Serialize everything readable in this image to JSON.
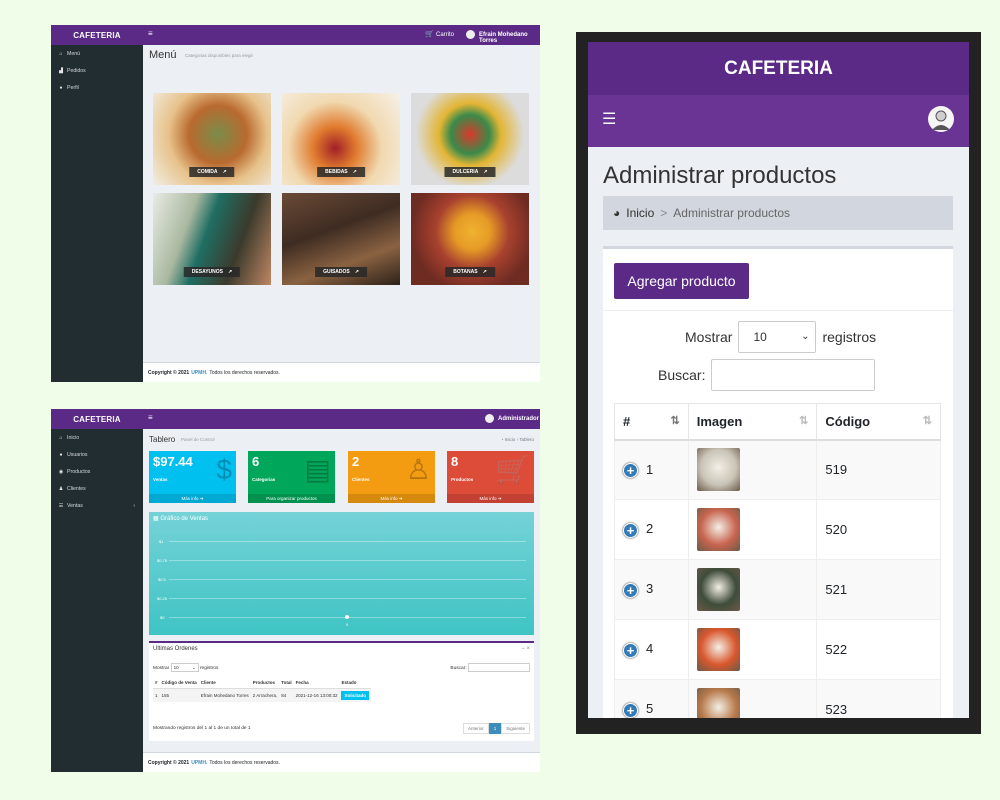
{
  "menu_screen": {
    "brand": "CAFETERIA",
    "topbar": {
      "cart_label": "Carrito",
      "user_name": "Efrain Mohedano Torres"
    },
    "sidebar": [
      {
        "icon": "home-icon",
        "label": "Menú"
      },
      {
        "icon": "chart-icon",
        "label": "Pedidos"
      },
      {
        "icon": "user-icon",
        "label": "Perfil"
      }
    ],
    "title": "Menú",
    "subtitle": "Categorias disponibles para elegir",
    "categories": [
      "COMIDA",
      "BEBIDAS",
      "DULCERIA",
      "DESAYUNOS",
      "GUISADOS",
      "BOTANAS"
    ],
    "footer": {
      "copyright": "Copyright © 2021",
      "company": "UPMH.",
      "rights": "Todos los derechos reservados."
    }
  },
  "dashboard_screen": {
    "brand": "CAFETERIA",
    "topbar": {
      "user_name": "Administrador"
    },
    "sidebar": [
      {
        "icon": "home-icon",
        "label": "Inicio"
      },
      {
        "icon": "user-icon",
        "label": "Usuarios"
      },
      {
        "icon": "box-icon",
        "label": "Productos"
      },
      {
        "icon": "users-icon",
        "label": "Clientes"
      },
      {
        "icon": "list-icon",
        "label": "Ventas"
      }
    ],
    "title": "Tablero",
    "subtitle": "Panel de Control",
    "breadcrumb": {
      "home": "Inicio",
      "current": "Tablero"
    },
    "boxes": [
      {
        "value": "$97.44",
        "label": "Ventas",
        "more": "Más info",
        "color": "#00c0ef"
      },
      {
        "value": "6",
        "label": "Categorias",
        "more": "Para organizar productos",
        "color": "#00a65a"
      },
      {
        "value": "2",
        "label": "Clientes",
        "more": "Más info",
        "color": "#f39c12"
      },
      {
        "value": "8",
        "label": "Productos",
        "more": "Más info",
        "color": "#dd4b39"
      }
    ],
    "graph": {
      "title": "Gráfico de Ventas",
      "ticks": [
        "$1",
        "$0.75",
        "$0.5",
        "$0.25",
        "$0"
      ],
      "x_tick": "0"
    },
    "orders": {
      "title": "Ultimas Ordenes",
      "show_label": "Mostrar",
      "show_value": "10",
      "records_label": "registros",
      "search_label": "Buscar:",
      "columns": [
        "#",
        "Código de Venta",
        "Cliente",
        "Productos",
        "Total",
        "Fecha",
        "Estado"
      ],
      "rows": [
        {
          "num": "1",
          "code": "155",
          "client": "Efrain Mohedano Torres",
          "products": "2 Arrachera,",
          "total": "84",
          "date": "2021-12-16 13:00:32",
          "status": "Solicitado"
        }
      ],
      "summary": "Mostrando registros del 1 al 1 de un total de 1",
      "prev": "Anterior",
      "page": "1",
      "next": "Siguiente"
    },
    "footer": {
      "copyright": "Copyright © 2021",
      "company": "UPMH.",
      "rights": "Todos los derechos reservados."
    }
  },
  "mobile_screen": {
    "brand": "CAFETERIA",
    "title": "Administrar productos",
    "breadcrumb": {
      "home": "Inicio",
      "separator": ">",
      "current": "Administrar productos"
    },
    "add_button": "Agregar producto",
    "show_label": "Mostrar",
    "show_value": "10",
    "records_label": "registros",
    "search_label": "Buscar:",
    "columns": [
      "#",
      "Imagen",
      "Código"
    ],
    "rows": [
      {
        "num": "1",
        "code": "519",
        "thumb_color": "#c9c4b6"
      },
      {
        "num": "2",
        "code": "520",
        "thumb_color": "#c8654f"
      },
      {
        "num": "3",
        "code": "521",
        "thumb_color": "#3f4c3a"
      },
      {
        "num": "4",
        "code": "522",
        "thumb_color": "#d9572d"
      },
      {
        "num": "5",
        "code": "523",
        "thumb_color": "#b87a4b"
      }
    ]
  }
}
